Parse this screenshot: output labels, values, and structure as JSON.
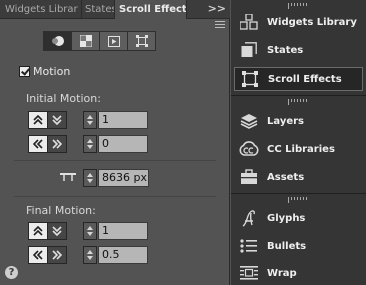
{
  "colors": {
    "panel": "#535353",
    "dock": "#353535",
    "field": "#b6b6b6",
    "selected_dock_item": "#262626"
  },
  "tabs": [
    {
      "label": "Widgets Librar",
      "active": false
    },
    {
      "label": "States",
      "active": false
    },
    {
      "label": "Scroll Effects",
      "active": true
    }
  ],
  "overflow_label": ">>",
  "mode_buttons": [
    {
      "icon": "scroll-motion-icon",
      "selected": true
    },
    {
      "icon": "background-fill-icon",
      "selected": false
    },
    {
      "icon": "slideshow-icon",
      "selected": false
    },
    {
      "icon": "adobe-edge-animate-icon",
      "selected": false
    }
  ],
  "motion": {
    "label": "Motion",
    "checked": true
  },
  "initial_motion": {
    "label": "Initial Motion:",
    "vertical_value": "1",
    "horizontal_value": "0"
  },
  "key_position": {
    "value": "8636 px"
  },
  "final_motion": {
    "label": "Final Motion:",
    "vertical_value": "1",
    "horizontal_value": "0.5"
  },
  "help_label": "?",
  "dock": {
    "groups": [
      {
        "items": [
          {
            "label": "Widgets Library",
            "icon": "widgets-library-icon",
            "selected": false
          },
          {
            "label": "States",
            "icon": "states-icon",
            "selected": false
          },
          {
            "label": "Scroll Effects",
            "icon": "scroll-effects-icon",
            "selected": true
          }
        ]
      },
      {
        "items": [
          {
            "label": "Layers",
            "icon": "layers-icon",
            "selected": false
          },
          {
            "label": "CC Libraries",
            "icon": "cc-libraries-icon",
            "selected": false
          },
          {
            "label": "Assets",
            "icon": "assets-icon",
            "selected": false
          }
        ]
      },
      {
        "items": [
          {
            "label": "Glyphs",
            "icon": "glyphs-icon",
            "selected": false
          },
          {
            "label": "Bullets",
            "icon": "bullets-icon",
            "selected": false
          },
          {
            "label": "Wrap",
            "icon": "wrap-icon",
            "selected": false
          }
        ]
      }
    ]
  }
}
